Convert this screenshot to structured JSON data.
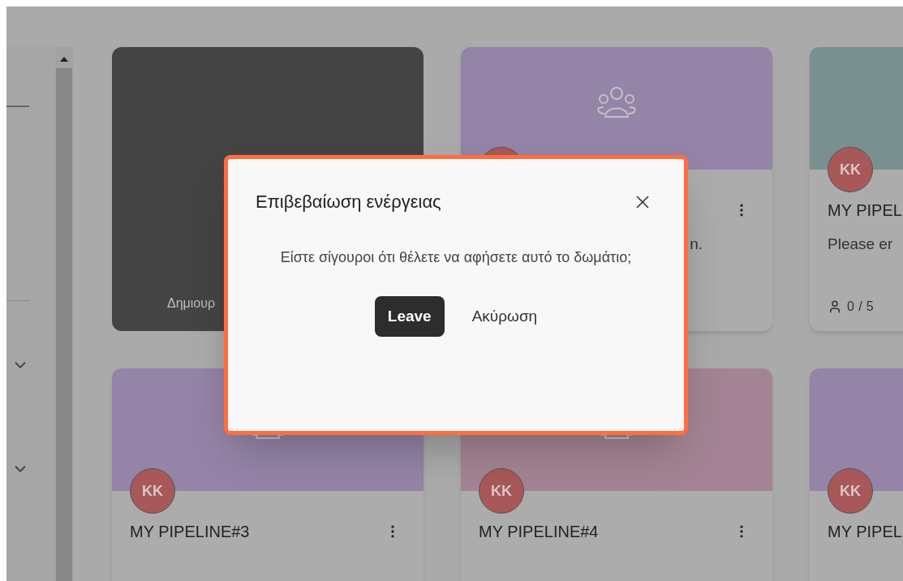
{
  "sidebar": {
    "sections": [
      {
        "expanded": false
      },
      {
        "expanded": false
      }
    ]
  },
  "cards": [
    {
      "kind": "create",
      "label": "Δημιουρ"
    },
    {
      "kind": "room_covered",
      "color": "#9484a8",
      "description": "n."
    },
    {
      "kind": "room",
      "color": "#7a9090",
      "avatar": "KK",
      "title": "MY PIPEL",
      "description": "Please er",
      "members": "0 / 5"
    },
    {
      "kind": "room",
      "color": "#9484a8",
      "avatar": "KK",
      "title": "MY PIPELINE#3"
    },
    {
      "kind": "room",
      "color": "#a48494",
      "avatar": "KK",
      "title": "MY PIPELINE#4"
    },
    {
      "kind": "room",
      "color": "#9484a8",
      "avatar": "KK",
      "title": "MY PIPEL"
    }
  ],
  "dialog": {
    "title": "Επιβεβαίωση ενέργειας",
    "message": "Είστε σίγουροι ότι θέλετε να αφήσετε αυτό το δωμάτιο;",
    "buttons": [
      {
        "label": "Leave",
        "kind": "primary"
      },
      {
        "label": "Ακύρωση",
        "kind": "text"
      }
    ]
  }
}
